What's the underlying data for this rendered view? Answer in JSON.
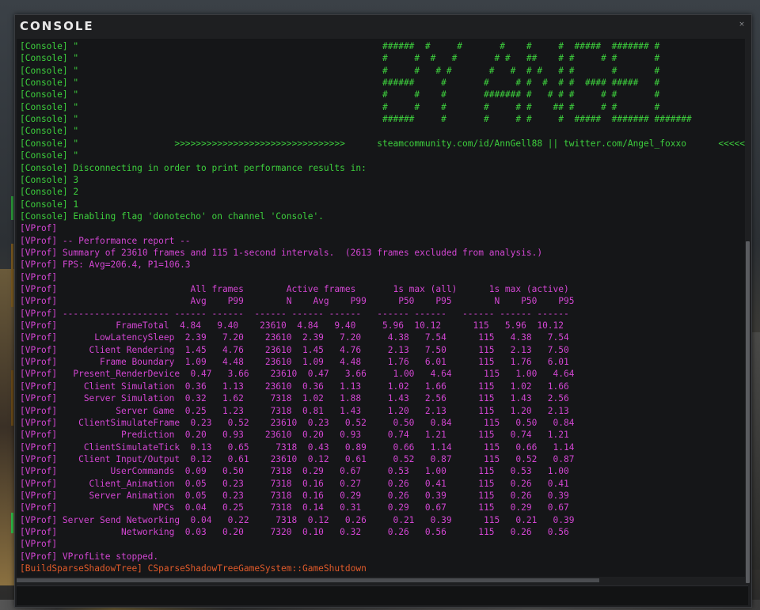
{
  "window": {
    "title": "CONSOLE",
    "close_glyph": "×"
  },
  "input": {
    "value": "",
    "placeholder": ""
  },
  "lines": [
    {
      "text": "[Console] \"                                                         ######  #     #       #    #     #  #####  ####### #",
      "color": "green"
    },
    {
      "text": "[Console] \"                                                         #     #  #   #       # #   ##    # #     # #       #",
      "color": "green"
    },
    {
      "text": "[Console] \"                                                         #     #   # #       #   #  # #   # #       #       #",
      "color": "green"
    },
    {
      "text": "[Console] \"                                                         ######     #       #     # #  #  # #  #### #####   #",
      "color": "green"
    },
    {
      "text": "[Console] \"                                                         #     #    #       ####### #   # # #     # #       #",
      "color": "green"
    },
    {
      "text": "[Console] \"                                                         #     #    #       #     # #    ## #     # #       #",
      "color": "green"
    },
    {
      "text": "[Console] \"                                                         ######     #       #     # #     #  #####  ####### #######",
      "color": "green"
    },
    {
      "text": "[Console] \"",
      "color": "green"
    },
    {
      "text": "[Console] \"                  >>>>>>>>>>>>>>>>>>>>>>>>>>>>>>>>      steamcommunity.com/id/AnnGell88 || twitter.com/Angel_foxxo      <<<<<<<<<<<",
      "color": "green"
    },
    {
      "text": "[Console] \"",
      "color": "green"
    },
    {
      "text": "[Console] Disconnecting in order to print performance results in:",
      "color": "green"
    },
    {
      "text": "[Console] 3",
      "color": "green"
    },
    {
      "text": "[Console] 2",
      "color": "green"
    },
    {
      "text": "[Console] 1",
      "color": "green"
    },
    {
      "text": "[Console] Enabling flag 'donotecho' on channel 'Console'.",
      "color": "green"
    },
    {
      "text": "[VProf]",
      "color": "magenta"
    },
    {
      "text": "[VProf] -- Performance report --",
      "color": "magenta"
    },
    {
      "text": "[VProf] Summary of 23610 frames and 115 1-second intervals.  (2613 frames excluded from analysis.)",
      "color": "magenta"
    },
    {
      "text": "[VProf] FPS: Avg=206.4, P1=106.3",
      "color": "magenta"
    },
    {
      "text": "[VProf]",
      "color": "magenta"
    },
    {
      "text": "[VProf]                         All frames        Active frames       1s max (all)      1s max (active)",
      "color": "magenta"
    },
    {
      "text": "[VProf]                         Avg    P99        N    Avg    P99      P50    P95        N    P50    P95",
      "color": "magenta"
    },
    {
      "text": "[VProf] -------------------- ------ ------  ------ ------ ------   ------ ------   ------ ------ ------",
      "color": "magenta"
    },
    {
      "text": "[VProf]           FrameTotal  4.84   9.40    23610  4.84   9.40     5.96  10.12      115   5.96  10.12",
      "color": "magenta"
    },
    {
      "text": "[VProf]       LowLatencySleep  2.39   7.20    23610  2.39   7.20     4.38   7.54      115   4.38   7.54",
      "color": "magenta"
    },
    {
      "text": "[VProf]      Client Rendering  1.45   4.76    23610  1.45   4.76     2.13   7.50      115   2.13   7.50",
      "color": "magenta"
    },
    {
      "text": "[VProf]        Frame Boundary  1.09   4.48    23610  1.09   4.48     1.76   6.01      115   1.76   6.01",
      "color": "magenta"
    },
    {
      "text": "[VProf]   Present_RenderDevice  0.47   3.66    23610  0.47   3.66     1.00   4.64      115   1.00   4.64",
      "color": "magenta"
    },
    {
      "text": "[VProf]     Client Simulation  0.36   1.13    23610  0.36   1.13     1.02   1.66      115   1.02   1.66",
      "color": "magenta"
    },
    {
      "text": "[VProf]     Server Simulation  0.32   1.62     7318  1.02   1.88     1.43   2.56      115   1.43   2.56",
      "color": "magenta"
    },
    {
      "text": "[VProf]           Server Game  0.25   1.23     7318  0.81   1.43     1.20   2.13      115   1.20   2.13",
      "color": "magenta"
    },
    {
      "text": "[VProf]    ClientSimulateFrame  0.23   0.52    23610  0.23   0.52     0.50   0.84      115   0.50   0.84",
      "color": "magenta"
    },
    {
      "text": "[VProf]            Prediction  0.20   0.93    23610  0.20   0.93     0.74   1.21      115   0.74   1.21",
      "color": "magenta"
    },
    {
      "text": "[VProf]     ClientSimulateTick  0.13   0.65     7318  0.43   0.89     0.66   1.14      115   0.66   1.14",
      "color": "magenta"
    },
    {
      "text": "[VProf]    Client Input/Output  0.12   0.61    23610  0.12   0.61     0.52   0.87      115   0.52   0.87",
      "color": "magenta"
    },
    {
      "text": "[VProf]          UserCommands  0.09   0.50     7318  0.29   0.67     0.53   1.00      115   0.53   1.00",
      "color": "magenta"
    },
    {
      "text": "[VProf]      Client_Animation  0.05   0.23     7318  0.16   0.27     0.26   0.41      115   0.26   0.41",
      "color": "magenta"
    },
    {
      "text": "[VProf]      Server Animation  0.05   0.23     7318  0.16   0.29     0.26   0.39      115   0.26   0.39",
      "color": "magenta"
    },
    {
      "text": "[VProf]                  NPCs  0.04   0.25     7318  0.14   0.31     0.29   0.67      115   0.29   0.67",
      "color": "magenta"
    },
    {
      "text": "[VProf] Server Send Networking  0.04   0.22     7318  0.12   0.26     0.21   0.39      115   0.21   0.39",
      "color": "magenta"
    },
    {
      "text": "[VProf]            Networking  0.03   0.20     7320  0.10   0.32     0.26   0.56      115   0.26   0.56",
      "color": "magenta"
    },
    {
      "text": "[VProf]",
      "color": "magenta"
    },
    {
      "text": "[VProf] VProfLite stopped.",
      "color": "magenta"
    },
    {
      "text": "[BuildSparseShadowTree] CSparseShadowTreeGameSystem::GameShutdown",
      "color": "orange"
    }
  ]
}
